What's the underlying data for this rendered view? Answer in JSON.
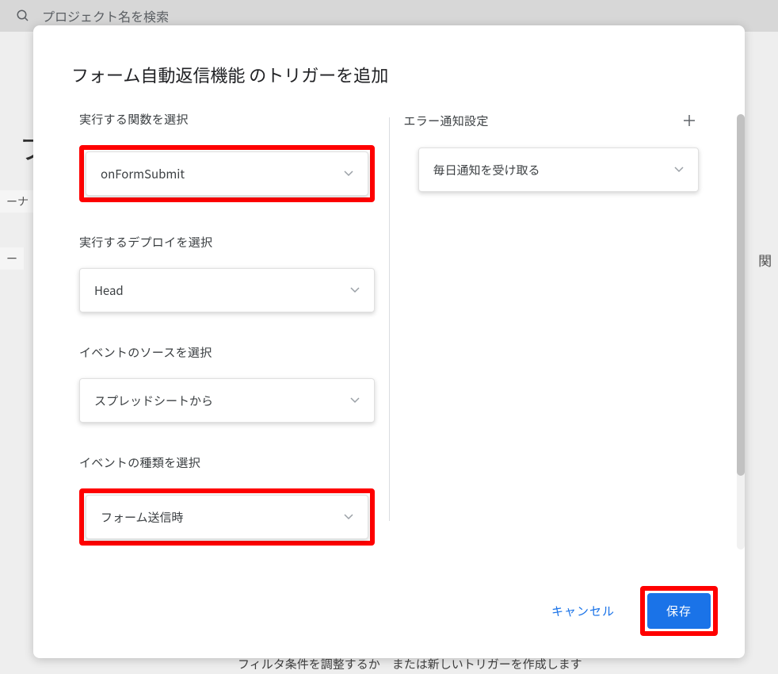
{
  "background": {
    "search_placeholder": "プロジェクト名を検索",
    "title_char": "フ",
    "tab1": "ーナ",
    "tab2": "ー",
    "tab3": "関",
    "bottom_text": "フィルタ条件を調整するか　または新しいトリガーを作成します"
  },
  "dialog": {
    "title": "フォーム自動返信機能 のトリガーを追加",
    "left": {
      "function_label": "実行する関数を選択",
      "function_value": "onFormSubmit",
      "deploy_label": "実行するデプロイを選択",
      "deploy_value": "Head",
      "source_label": "イベントのソースを選択",
      "source_value": "スプレッドシートから",
      "type_label": "イベントの種類を選択",
      "type_value": "フォーム送信時"
    },
    "right": {
      "error_label": "エラー通知設定",
      "error_value": "毎日通知を受け取る"
    },
    "footer": {
      "cancel": "キャンセル",
      "save": "保存"
    }
  }
}
